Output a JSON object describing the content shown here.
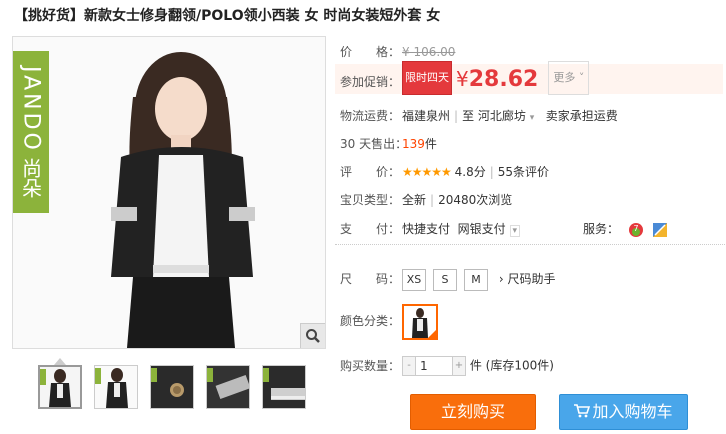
{
  "product": {
    "title": "【挑好货】新款女士修身翻领/POLO领小西装 女 时尚女装短外套 女"
  },
  "brand": {
    "en": "JANDO",
    "cn": "尚朵"
  },
  "colors": {
    "accent": "#e4393c",
    "brand_green": "#8cb33b",
    "buy": "#f96e0c",
    "cart": "#49a6ea"
  },
  "info": {
    "price_label": "价　　格：",
    "original_price": "¥ 106.00",
    "promo_label": "参加促销：",
    "promo_tag": "限时四天",
    "currency": "¥",
    "promo_price": "28.62",
    "more": "更多",
    "shipping_label": "物流运费：",
    "ship_from": "福建泉州",
    "ship_to_prefix": "至",
    "ship_to": "河北廊坊",
    "ship_fee": "卖家承担运费",
    "sold_label": "30 天售出：",
    "sold_count": "139",
    "sold_unit": "件",
    "rating_label": "评　　价：",
    "rating_stars": "★★★★★",
    "rating_value": "4.8分",
    "reviews": "55条评价",
    "type_label": "宝贝类型：",
    "condition": "全新",
    "views": "20480次浏览",
    "pay_label": "支　　付：",
    "pay_1": "快捷支付",
    "pay_2": "网银支付",
    "service_label": "服务："
  },
  "options": {
    "size_label": "尺　　码：",
    "sizes": [
      "XS",
      "S",
      "M"
    ],
    "size_helper": "› 尺码助手",
    "color_label": "颜色分类：",
    "qty_label": "购买数量：",
    "qty_minus": "-",
    "qty_value": "1",
    "qty_plus": "+",
    "qty_stock": "件 (库存100件)"
  },
  "actions": {
    "buy": "立刻购买",
    "cart": "加入购物车"
  }
}
